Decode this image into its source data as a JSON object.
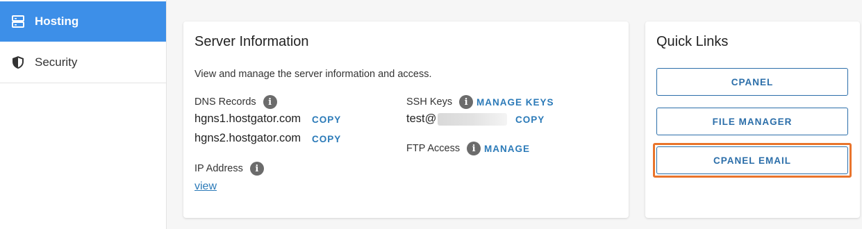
{
  "sidebar": {
    "items": [
      {
        "label": "Hosting",
        "icon": "server-icon",
        "active": true
      },
      {
        "label": "Security",
        "icon": "shield-icon",
        "active": false
      }
    ]
  },
  "server_info": {
    "title": "Server Information",
    "description": "View and manage the server information and access.",
    "dns": {
      "label": "DNS Records",
      "records": [
        {
          "value": "hgns1.hostgator.com",
          "action": "COPY"
        },
        {
          "value": "hgns2.hostgator.com",
          "action": "COPY"
        }
      ]
    },
    "ip": {
      "label": "IP Address",
      "link": "view"
    },
    "ssh": {
      "label": "SSH Keys",
      "manage": "MANAGE KEYS",
      "value": "test@",
      "action": "COPY"
    },
    "ftp": {
      "label": "FTP Access",
      "manage": "MANAGE"
    }
  },
  "quick_links": {
    "title": "Quick Links",
    "buttons": [
      "CPANEL",
      "FILE MANAGER",
      "CPANEL EMAIL"
    ]
  },
  "colors": {
    "accent": "#3d8fe8",
    "link": "#2b7ab8",
    "highlight": "#e9742c"
  }
}
